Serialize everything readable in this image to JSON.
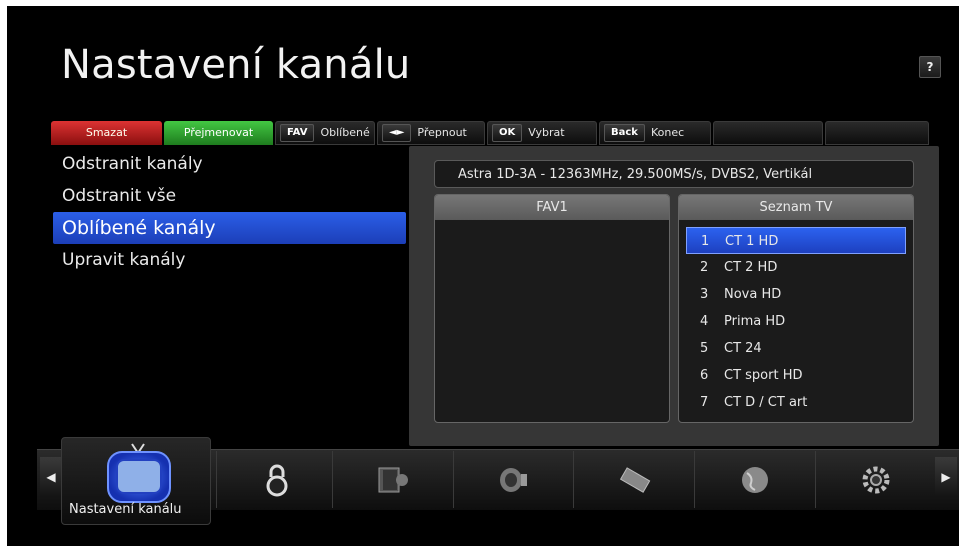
{
  "page": {
    "title": "Nastavení kanálu",
    "help": "?"
  },
  "toolbar": {
    "delete": "Smazat",
    "rename": "Přejmenovat",
    "fav_key": "FAV",
    "fav_label": "Oblíbené",
    "switch_key": "◄►",
    "switch_label": "Přepnout",
    "ok_key": "OK",
    "ok_label": "Vybrat",
    "back_key": "Back",
    "back_label": "Konec"
  },
  "menu": {
    "items": [
      {
        "label": "Odstranit kanály"
      },
      {
        "label": "Odstranit vše"
      },
      {
        "label": "Oblíbené kanály"
      },
      {
        "label": "Upravit kanály"
      }
    ],
    "active_index": 2
  },
  "satellite": "Astra 1D-3A - 12363MHz, 29.500MS/s, DVBS2, Vertikál",
  "fav_list": {
    "header": "FAV1",
    "items": []
  },
  "tv_list": {
    "header": "Seznam TV",
    "items": [
      {
        "num": "1",
        "name": "CT 1 HD"
      },
      {
        "num": "2",
        "name": "CT 2 HD"
      },
      {
        "num": "3",
        "name": "Nova HD"
      },
      {
        "num": "4",
        "name": "Prima HD"
      },
      {
        "num": "5",
        "name": "CT 24"
      },
      {
        "num": "6",
        "name": "CT sport HD"
      },
      {
        "num": "7",
        "name": "CT D / CT art"
      }
    ],
    "selected_index": 0
  },
  "dock": {
    "selected_label": "Nastavení kanálu",
    "icons": [
      "tv-icon",
      "lock-icon",
      "book-icon",
      "satellite-dish-icon",
      "card-icon",
      "globe-icon",
      "gear-icon"
    ]
  },
  "colors": {
    "accent_blue": "#2b5fe8",
    "red_key": "#c62020",
    "green_key": "#2ea82e"
  }
}
